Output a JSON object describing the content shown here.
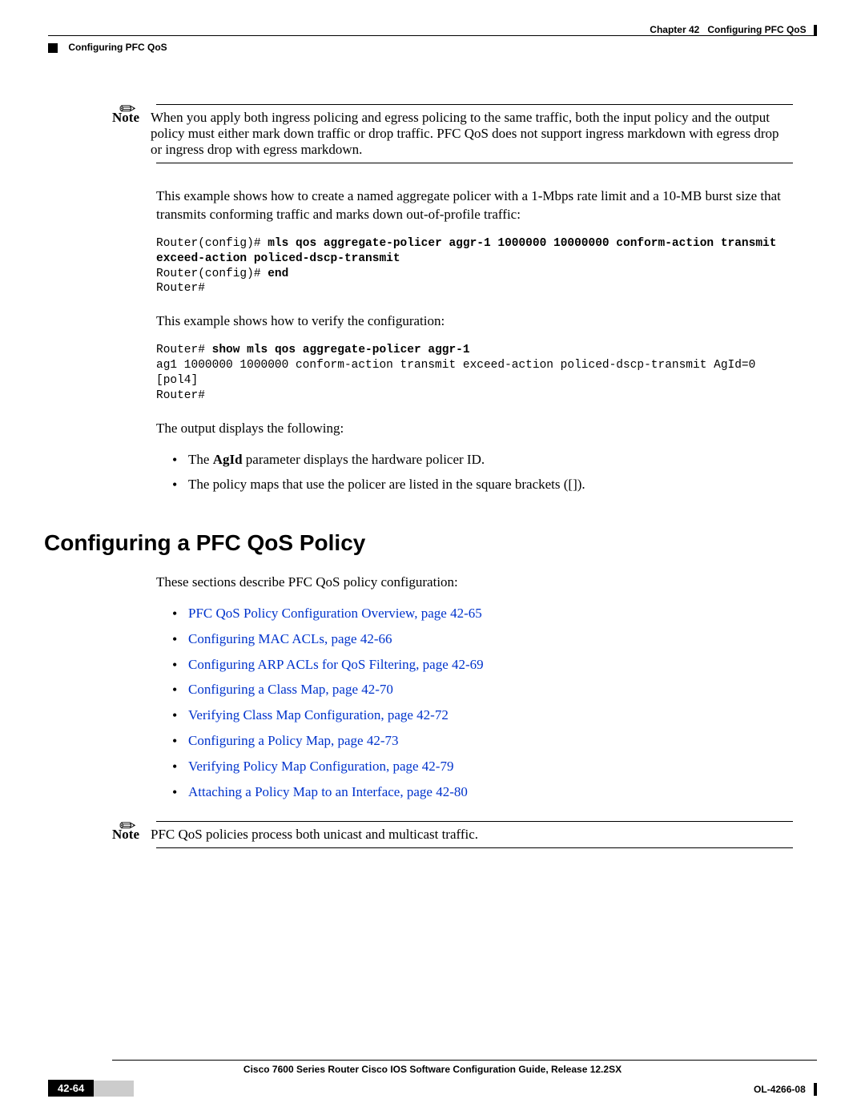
{
  "header": {
    "chapter": "Chapter 42",
    "title": "Configuring PFC QoS",
    "section": "Configuring PFC QoS"
  },
  "note1": {
    "label": "Note",
    "text": "When you apply both ingress policing and egress policing to the same traffic, both the input policy and the output policy must either mark down traffic or drop traffic. PFC QoS does not support ingress markdown with egress drop or ingress drop with egress markdown."
  },
  "para1": "This example shows how to create a named aggregate policer with a 1-Mbps rate limit and a 10-MB burst size that transmits conforming traffic and marks down out-of-profile traffic:",
  "code1": {
    "prompt1": "Router(config)# ",
    "cmd1": "mls qos aggregate-policer aggr-1 1000000 10000000 conform-action transmit exceed-action policed-dscp-transmit",
    "prompt2": "Router(config)# ",
    "cmd2": "end",
    "line3": "Router#"
  },
  "para2": "This example shows how to verify the configuration:",
  "code2": {
    "prompt1": "Router# ",
    "cmd1": "show mls qos aggregate-policer aggr-1",
    "line2": "ag1 1000000 1000000 conform-action transmit exceed-action policed-dscp-transmit AgId=0 [pol4]",
    "line3": "Router#"
  },
  "para3": "The output displays the following:",
  "output_bullets": [
    {
      "pre": "The ",
      "bold": "AgId",
      "post": " parameter displays the hardware policer ID."
    },
    {
      "pre": "The policy maps that use the policer are listed in the square brackets ([]).",
      "bold": "",
      "post": ""
    }
  ],
  "heading": "Configuring a PFC QoS Policy",
  "para4": "These sections describe PFC QoS policy configuration:",
  "links": [
    "PFC QoS Policy Configuration Overview, page 42-65",
    "Configuring MAC ACLs, page 42-66",
    "Configuring ARP ACLs for QoS Filtering, page 42-69",
    "Configuring a Class Map, page 42-70",
    "Verifying Class Map Configuration, page 42-72",
    "Configuring a Policy Map, page 42-73",
    "Verifying Policy Map Configuration, page 42-79",
    "Attaching a Policy Map to an Interface, page 42-80"
  ],
  "note2": {
    "label": "Note",
    "text": "PFC QoS policies process both unicast and multicast traffic."
  },
  "footer": {
    "title": "Cisco 7600 Series Router Cisco IOS Software Configuration Guide, Release 12.2SX",
    "page": "42-64",
    "docid": "OL-4266-08"
  }
}
